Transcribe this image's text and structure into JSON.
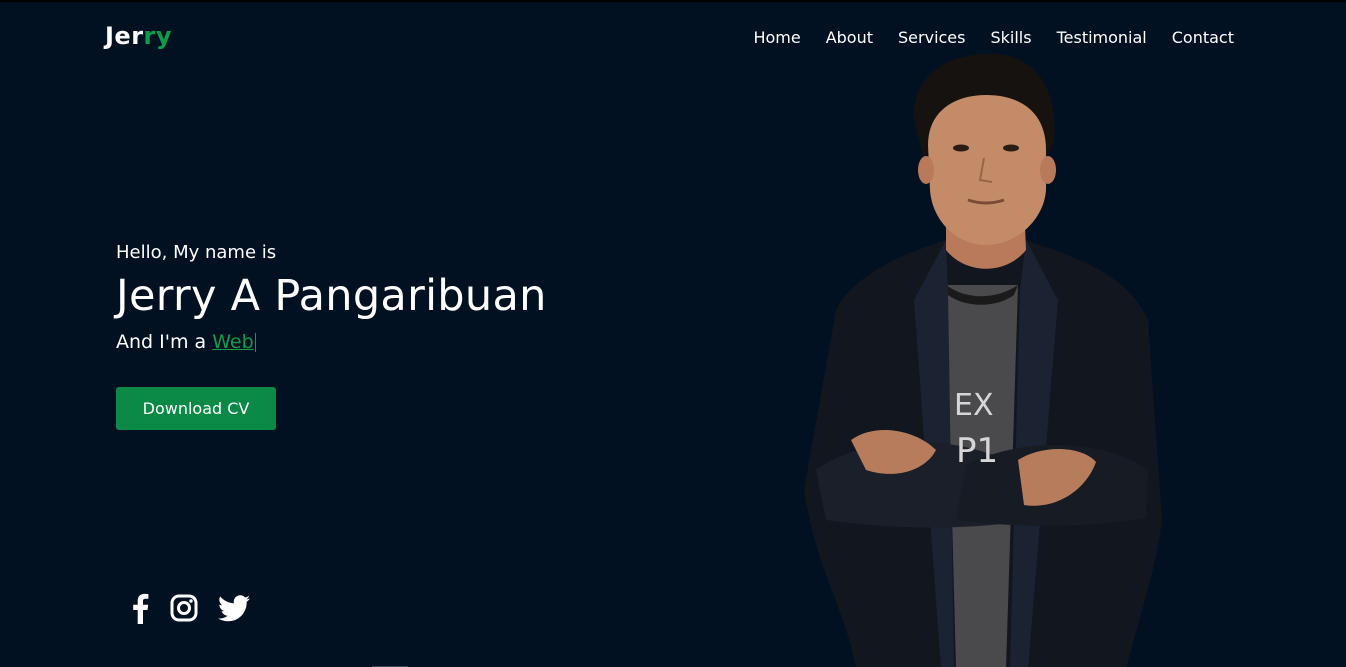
{
  "header": {
    "logo_part1": "Jer",
    "logo_part2": "ry",
    "nav": [
      "Home",
      "About",
      "Services",
      "Skills",
      "Testimonial",
      "Contact"
    ]
  },
  "hero": {
    "greeting": "Hello, My name is",
    "name": "Jerry A Pangaribuan",
    "role_prefix": "And I'm a ",
    "role_typed": "Web",
    "cta_label": "Download CV"
  },
  "socials": [
    "facebook-icon",
    "instagram-icon",
    "twitter-icon"
  ],
  "colors": {
    "background": "#021122",
    "accent": "#0f9b4a",
    "button": "#0b8a47"
  }
}
